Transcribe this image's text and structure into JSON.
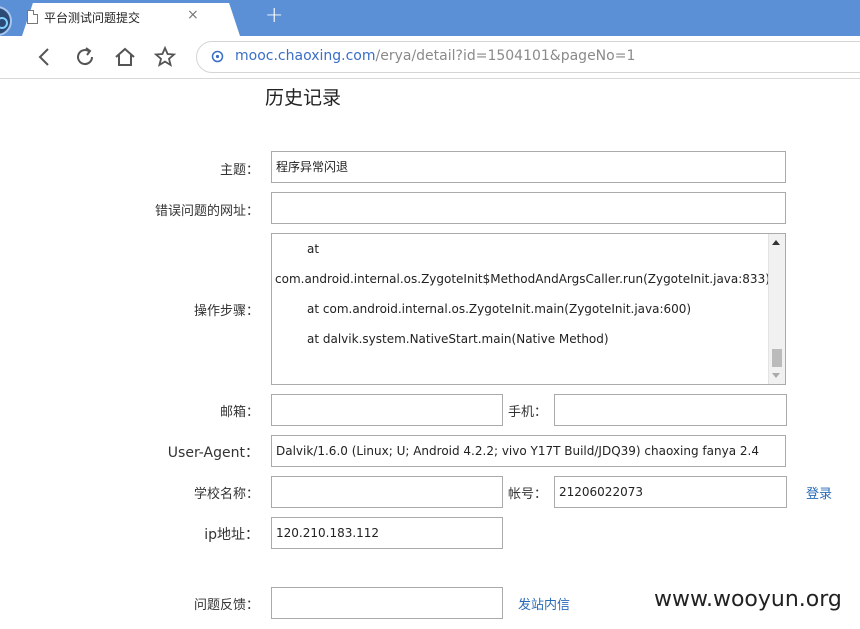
{
  "browser": {
    "tab_title": "平台测试问题提交",
    "tab_close": "×",
    "new_tab": "+",
    "url_host": "mooc.chaoxing.com",
    "url_path": "/erya/detail?id=1504101&pageNo=1"
  },
  "page": {
    "title": "历史记录"
  },
  "form": {
    "subject_label": "主题：",
    "subject_value": "程序异常闪退",
    "error_url_label": "错误问题的网址：",
    "error_url_value": "",
    "steps_label": "操作步骤：",
    "steps_lines": [
      "at",
      "com.android.internal.os.ZygoteInit$MethodAndArgsCaller.run(ZygoteInit.java:833)",
      "at com.android.internal.os.ZygoteInit.main(ZygoteInit.java:600)",
      "at dalvik.system.NativeStart.main(Native Method)"
    ],
    "email_label": "邮箱：",
    "email_value": "",
    "phone_label": "手机：",
    "phone_value": "",
    "ua_label": "User-Agent：",
    "ua_value": "Dalvik/1.6.0 (Linux; U; Android 4.2.2; vivo Y17T Build/JDQ39) chaoxing fanya 2.4",
    "school_label": "学校名称：",
    "school_value": "",
    "account_label": "帐号：",
    "account_value": "21206022073",
    "login_link": "登录",
    "ip_label": "ip地址：",
    "ip_value": "120.210.183.112",
    "feedback_label": "问题反馈：",
    "feedback_value": "",
    "message_link": "发站内信"
  },
  "watermark": "www.wooyun.org",
  "colors": {
    "tabbar": "#5b8fd6",
    "link": "#2a6bb8",
    "url_host": "#3a6fc5"
  }
}
